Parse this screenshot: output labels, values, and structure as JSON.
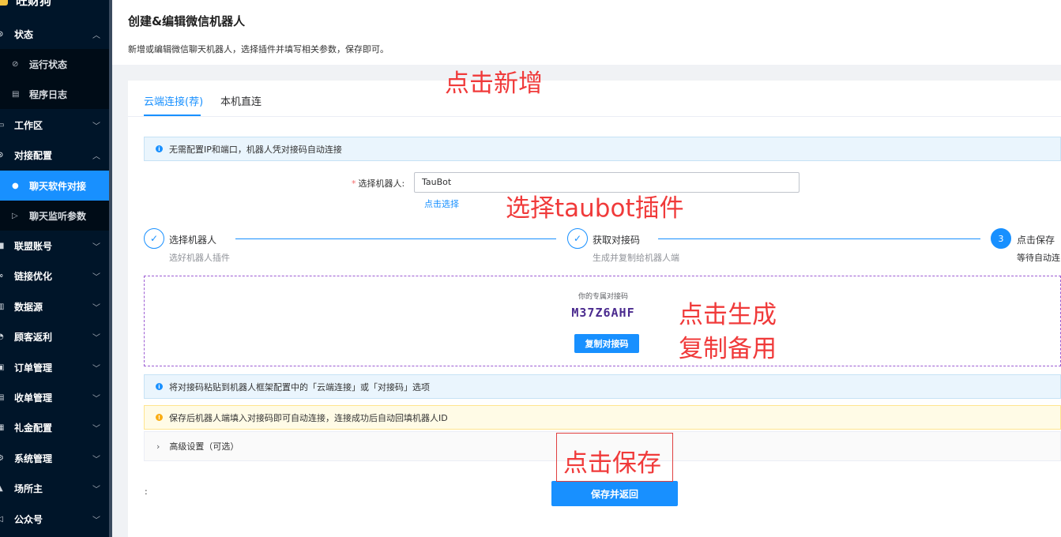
{
  "sidebar": {
    "logo_text": "旺财狗",
    "menu": [
      {
        "label": "状态",
        "icon": "gauge-icon",
        "expanded": true
      },
      {
        "label": "工作区",
        "icon": "workspace-icon"
      },
      {
        "label": "对接配置",
        "icon": "link-icon",
        "expanded": true
      },
      {
        "label": "联盟账号",
        "icon": "account-icon"
      },
      {
        "label": "链接优化",
        "icon": "chain-icon"
      },
      {
        "label": "数据源",
        "icon": "database-icon"
      },
      {
        "label": "顾客返利",
        "icon": "rebate-icon"
      },
      {
        "label": "订单管理",
        "icon": "order-icon"
      },
      {
        "label": "收单管理",
        "icon": "receipt-icon"
      },
      {
        "label": "礼金配置",
        "icon": "gift-icon"
      },
      {
        "label": "系统管理",
        "icon": "settings-icon"
      },
      {
        "label": "场所主",
        "icon": "venue-icon"
      },
      {
        "label": "公众号",
        "icon": "megaphone-icon"
      }
    ],
    "status_submenu": [
      {
        "label": "运行状态",
        "icon": "check-circle-icon"
      },
      {
        "label": "程序日志",
        "icon": "file-icon"
      }
    ],
    "config_submenu": [
      {
        "label": "聊天软件对接",
        "icon": "chat-icon",
        "active": true
      },
      {
        "label": "聊天监听参数",
        "icon": "send-icon"
      }
    ]
  },
  "header": {
    "title": "创建&编辑微信机器人",
    "description": "新增或编辑微信聊天机器人，选择插件并填写相关参数，保存即可。"
  },
  "tabs": [
    {
      "label": "云端连接(荐)",
      "active": true
    },
    {
      "label": "本机直连",
      "active": false
    }
  ],
  "info_alert": "无需配置IP和端口，机器人凭对接码自动连接",
  "form": {
    "robot_label": "选择机器人:",
    "robot_value": "TauBot",
    "pick_link": "点击选择"
  },
  "steps": [
    {
      "number": "1",
      "title": "选择机器人",
      "desc": "选好机器人插件",
      "done": true
    },
    {
      "number": "2",
      "title": "获取对接码",
      "desc": "生成并复制给机器人端",
      "done": true
    },
    {
      "number": "3",
      "title": "点击保存",
      "desc": "等待自动连",
      "done": false
    }
  ],
  "code_panel": {
    "caption": "你的专属对接码",
    "code": "M37Z6AHF",
    "copy_button": "复制对接码"
  },
  "paste_alert": "将对接码粘贴到机器人框架配置中的「云端连接」或「对接码」选项",
  "warn_alert": "保存后机器人端填入对接码即可自动连接，连接成功后自动回填机器人ID",
  "advanced_label": "高级设置（可选）",
  "colon_label": ":",
  "save_button": "保存并返回",
  "annotations": {
    "click_add": "点击新增",
    "select_plugin": "选择taubot插件",
    "click_generate": "点击生成",
    "copy_backup": "复制备用",
    "click_save": "点击保存"
  },
  "colors": {
    "primary": "#1890ff",
    "sidebar_bg": "#001529",
    "annotation": "#f03a3a"
  }
}
